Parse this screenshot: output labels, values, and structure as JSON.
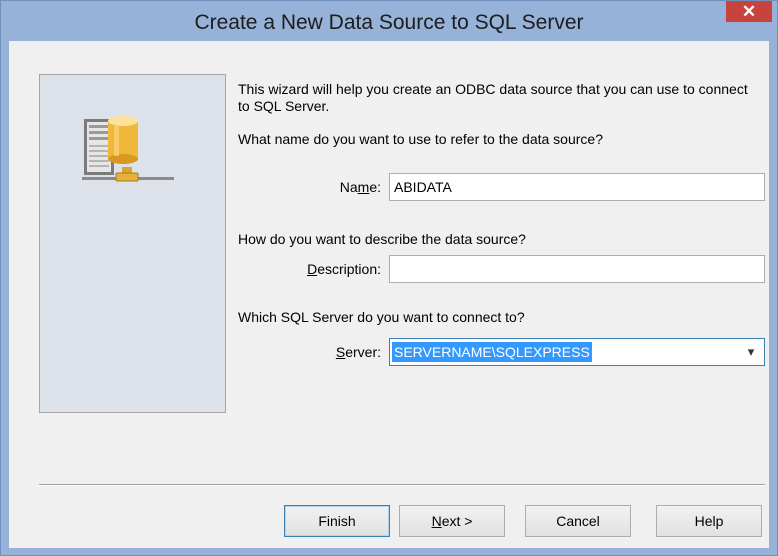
{
  "window": {
    "title": "Create a New Data Source to SQL Server",
    "close_glyph": "✕"
  },
  "icons": {
    "side": "database-server-icon",
    "close": "close-icon",
    "dropdown": "chevron-down-icon"
  },
  "intro_text": "This wizard will help you create an ODBC data source that you can use to connect to SQL Server.",
  "name_question": "What name do you want to use to refer to the data source?",
  "name_field": {
    "label_pre": "Na",
    "label_key": "m",
    "label_post": "e:",
    "value": "ABIDATA"
  },
  "description_question": "How do you want to describe the data source?",
  "description_field": {
    "label_key": "D",
    "label_post": "escription:",
    "value": ""
  },
  "server_question": "Which SQL Server do you want to connect to?",
  "server_field": {
    "label_key": "S",
    "label_post": "erver:",
    "value": "SERVERNAME\\SQLEXPRESS",
    "arrow": "▾"
  },
  "buttons": {
    "finish": "Finish",
    "next_key": "N",
    "next_post": "ext >",
    "cancel": "Cancel",
    "help": "Help"
  },
  "colors": {
    "frame": "#96b2d9",
    "close": "#c7443d",
    "selection": "#3399ff",
    "panel": "#dde1e9"
  }
}
